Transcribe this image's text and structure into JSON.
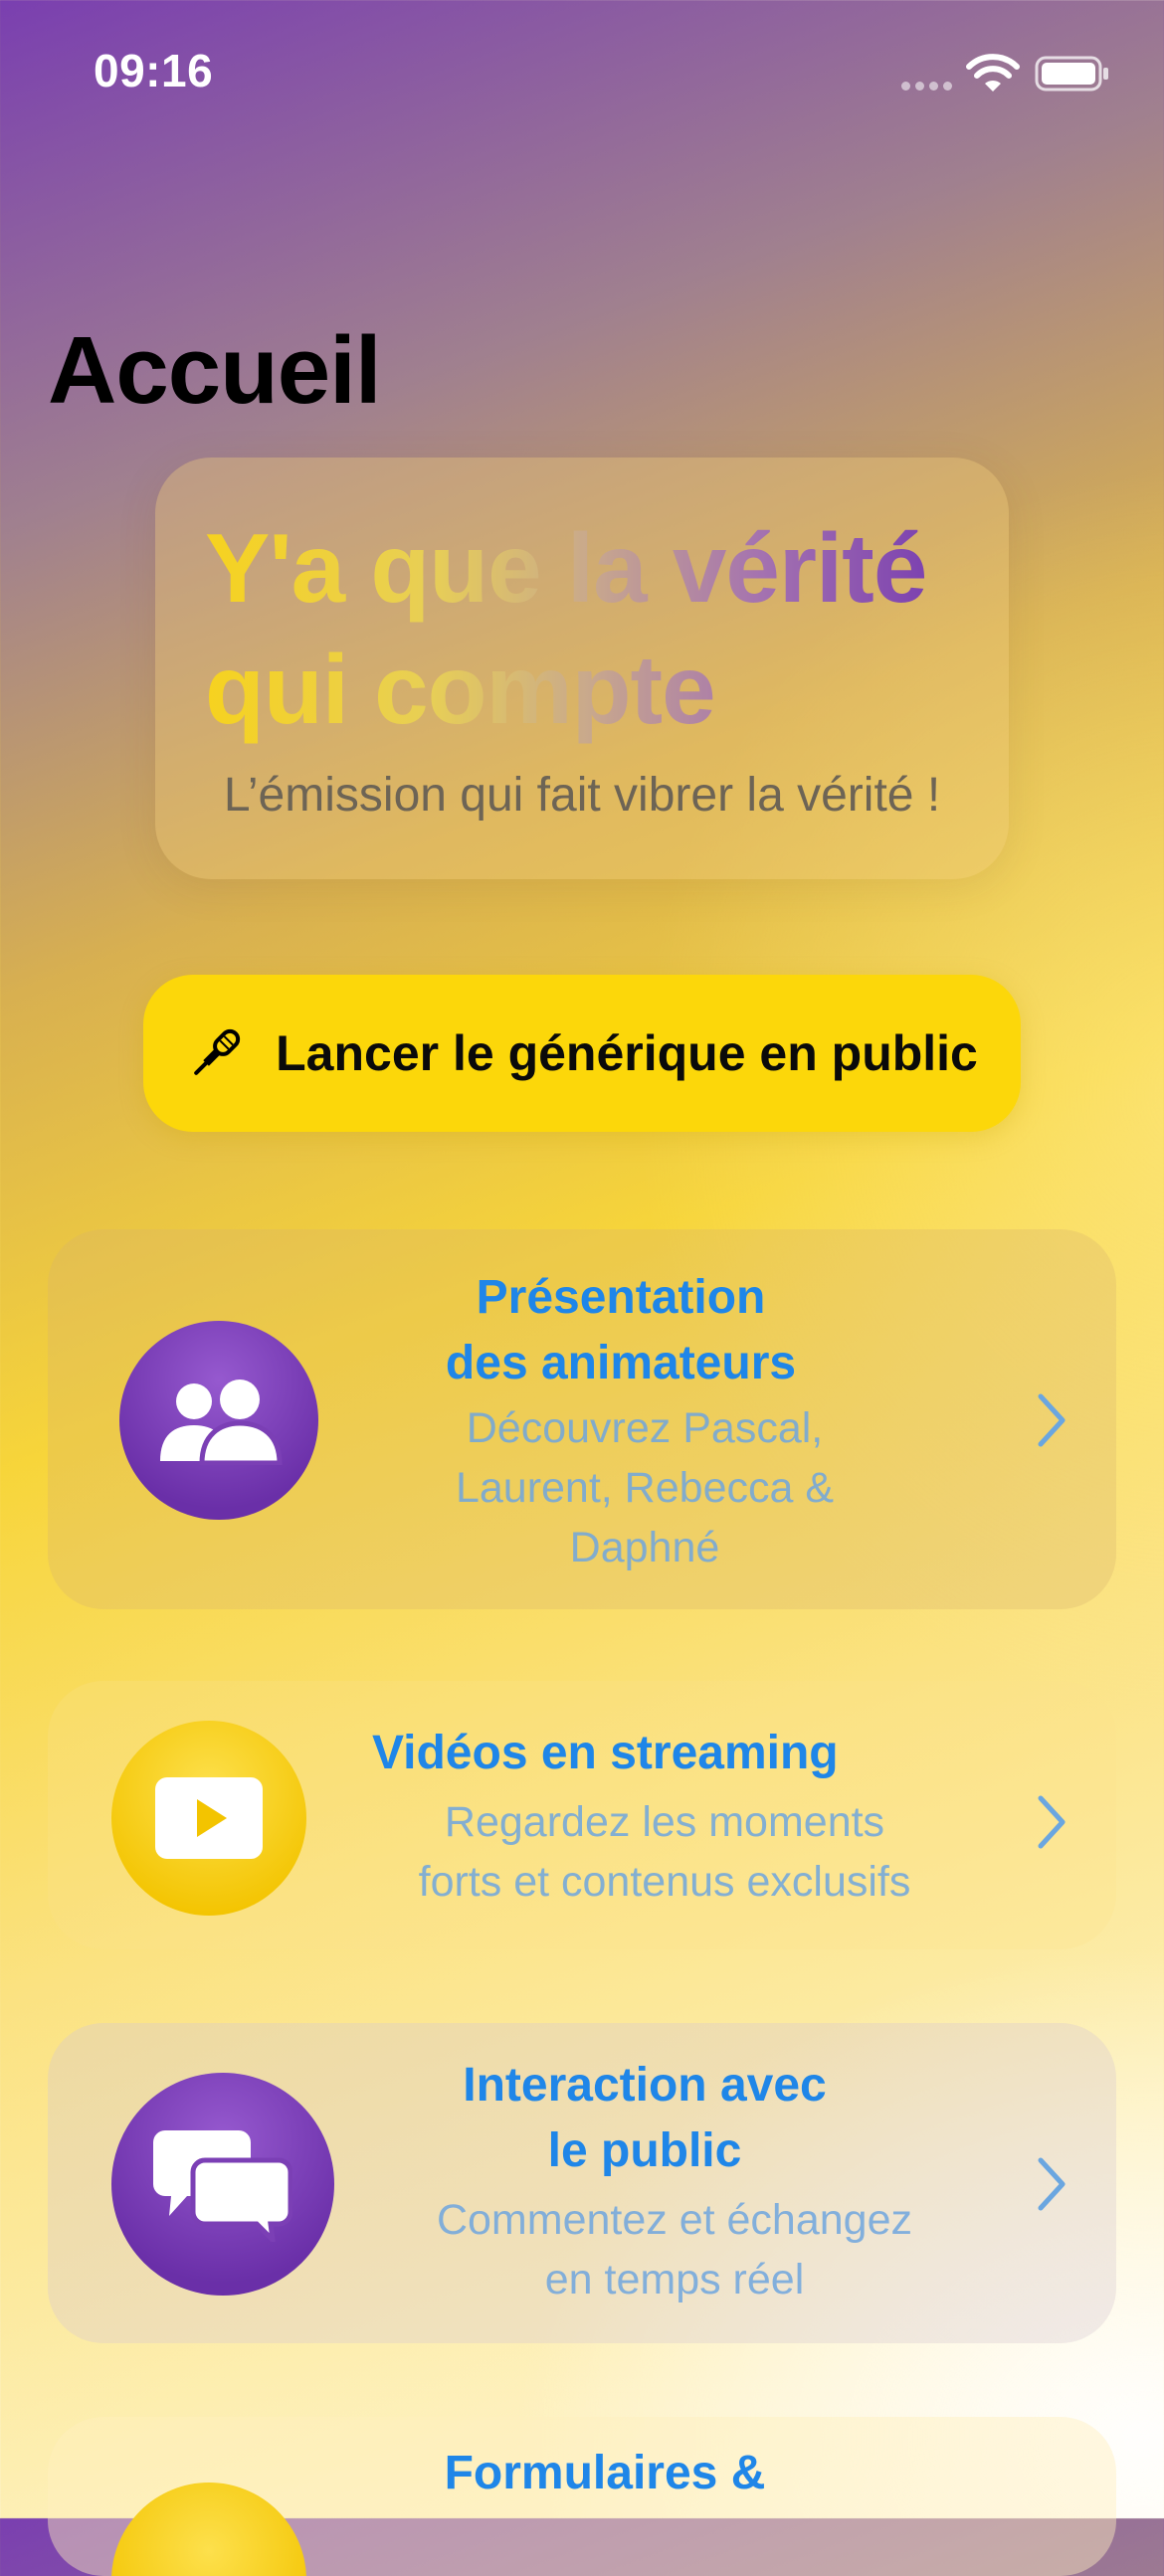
{
  "status_bar": {
    "time": "09:16"
  },
  "page": {
    "title": "Accueil"
  },
  "hero": {
    "title": "Y'a que la vérité qui compte",
    "subtitle": "L’émission qui fait vibrer la vérité !"
  },
  "launch_button": {
    "label": "Lancer le générique en public",
    "icon": "microphone-icon"
  },
  "cards": [
    {
      "title_line1": "Présentation",
      "title_line2": "des animateurs",
      "desc_line1": "Découvrez Pascal,",
      "desc_line2": "Laurent, Rebecca &",
      "desc_line3": "Daphné",
      "icon": "people-icon",
      "color": "#7b3fb5"
    },
    {
      "title_line1": "Vidéos en streaming",
      "desc_line1": "Regardez les moments",
      "desc_line2": "forts et contenus exclusifs",
      "icon": "play-icon",
      "color": "#f7cf0e"
    },
    {
      "title_line1": "Interaction avec",
      "title_line2": "le public",
      "desc_line1": "Commentez et échangez",
      "desc_line2": "en temps réel",
      "icon": "chat-bubbles-icon",
      "color": "#7b3fb5"
    },
    {
      "title_line1": "Formulaires &",
      "icon": "form-icon",
      "color": "#f7cf0e"
    }
  ],
  "colors": {
    "accent_blue": "#1f86e8",
    "brand_yellow": "#fcd70a",
    "brand_purple": "#7b3fb5"
  }
}
